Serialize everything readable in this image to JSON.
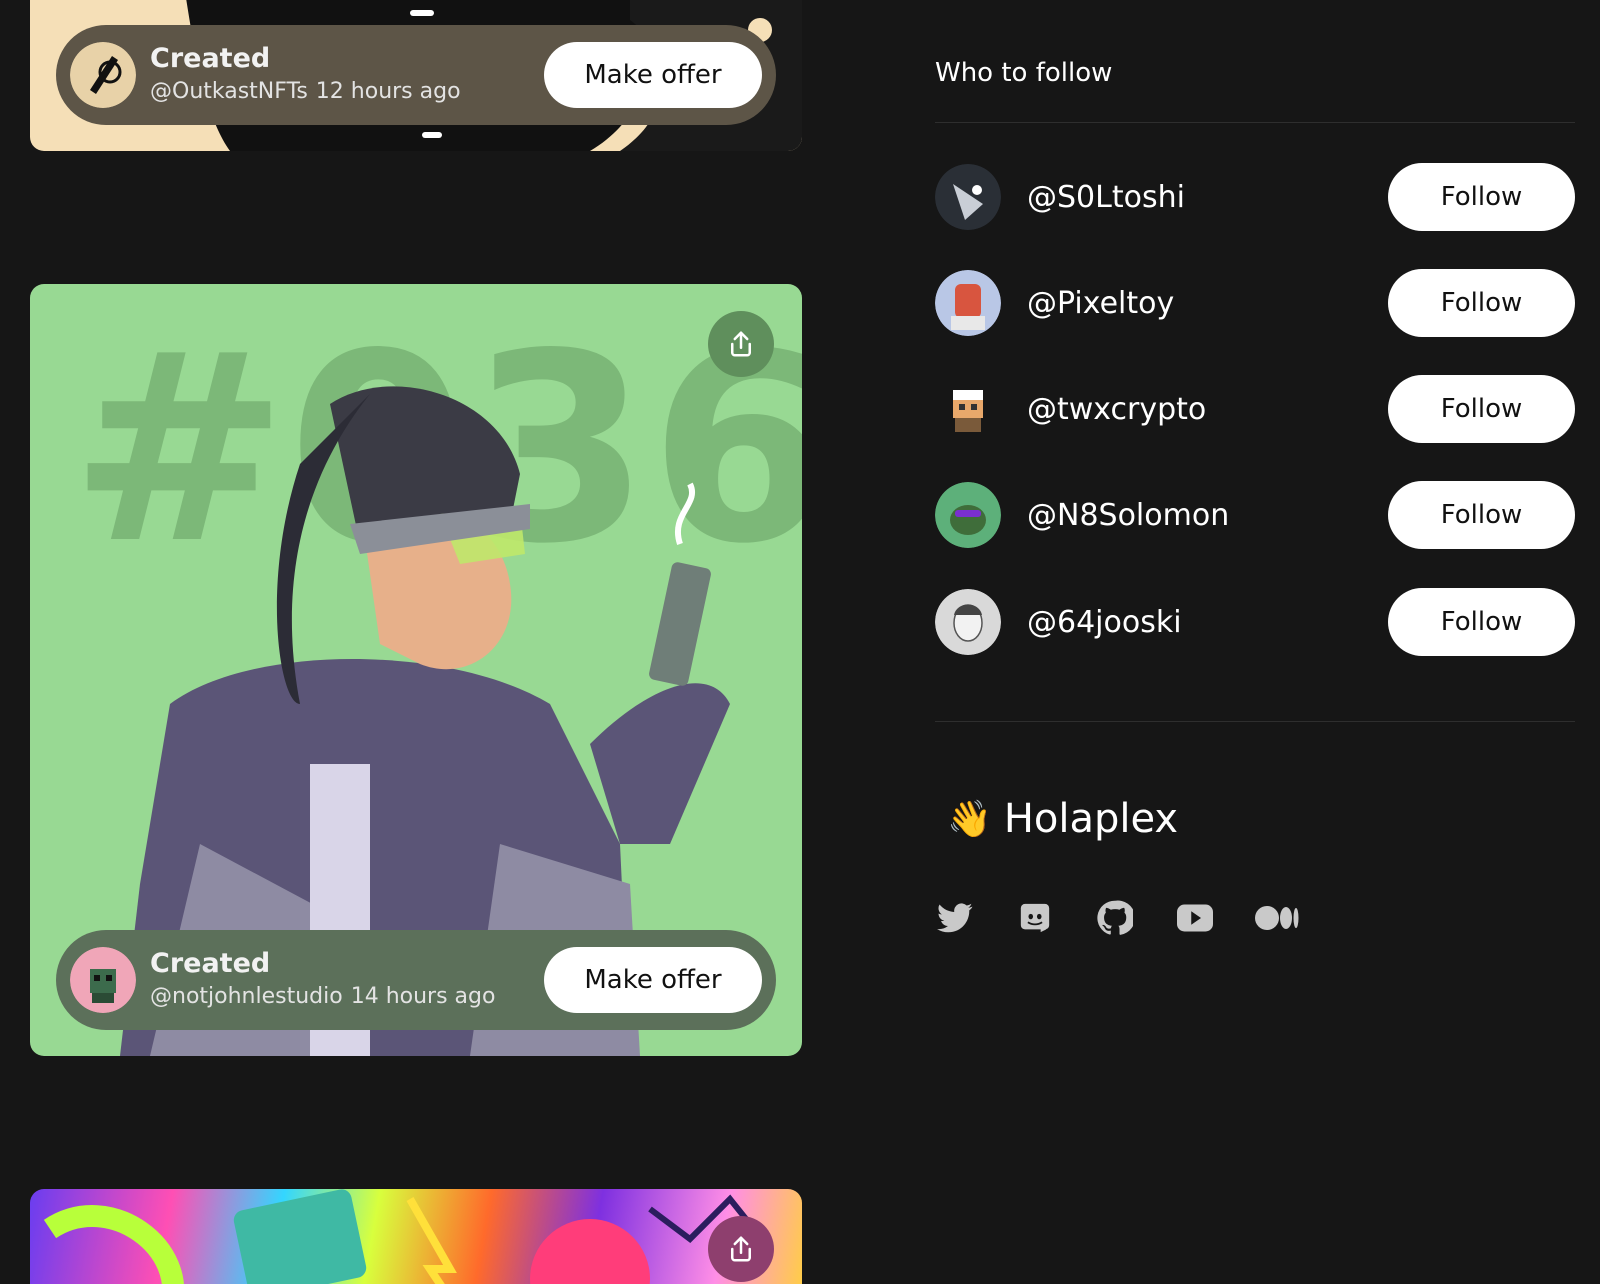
{
  "feed": {
    "cards": [
      {
        "status": "Created",
        "handle": "@OutkastNFTs",
        "time": "12 hours ago",
        "offer_label": "Make offer"
      },
      {
        "status": "Created",
        "handle": "@notjohnlestudio",
        "time": "14 hours ago",
        "offer_label": "Make offer",
        "artwork_text": "#036"
      }
    ]
  },
  "sidebar": {
    "title": "Who to follow",
    "accounts": [
      {
        "handle": "@S0Ltoshi",
        "button": "Follow"
      },
      {
        "handle": "@Pixeltoy",
        "button": "Follow"
      },
      {
        "handle": "@twxcrypto",
        "button": "Follow"
      },
      {
        "handle": "@N8Solomon",
        "button": "Follow"
      },
      {
        "handle": "@64jooski",
        "button": "Follow"
      }
    ],
    "brand": {
      "emoji": "👋",
      "name": "Holaplex"
    },
    "socials": [
      "twitter-icon",
      "discord-icon",
      "github-icon",
      "youtube-icon",
      "medium-icon"
    ]
  },
  "colors": {
    "background": "#161616",
    "card2_bg": "#98d993",
    "button_bg": "#ffffff"
  }
}
